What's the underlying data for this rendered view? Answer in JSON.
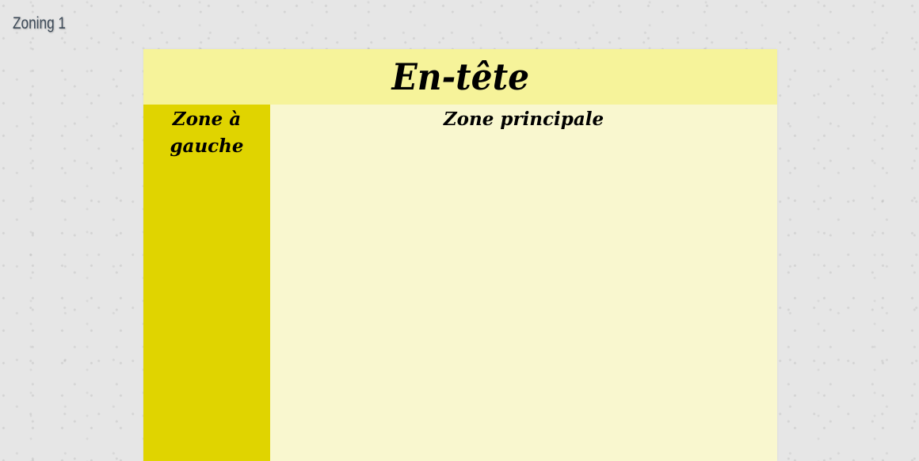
{
  "page": {
    "label": "Zoning 1"
  },
  "layout": {
    "header": {
      "title": "En-tête"
    },
    "sidebar": {
      "title": "Zone à gauche"
    },
    "main": {
      "title": "Zone principale"
    }
  },
  "colors": {
    "background": "#e6e6e6",
    "header": "#f6f39a",
    "sidebar": "#e0d400",
    "main": "#f9f7cf",
    "label": "#3d4a58"
  }
}
